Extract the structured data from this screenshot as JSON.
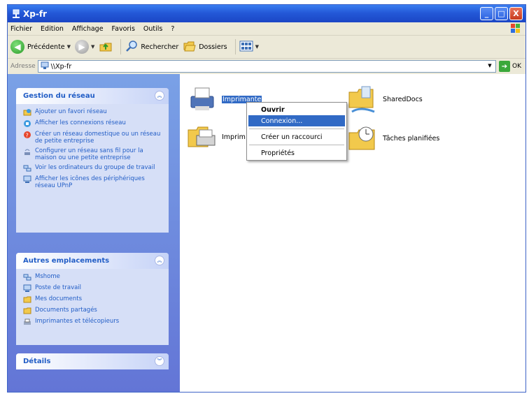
{
  "window": {
    "title": "Xp-fr",
    "buttons": {
      "minimize": "_",
      "maximize": "□",
      "close": "X"
    }
  },
  "menu": [
    "Fichier",
    "Edition",
    "Affichage",
    "Favoris",
    "Outils",
    "?"
  ],
  "toolbar": {
    "back_label": "Précédente",
    "search_label": "Rechercher",
    "folders_label": "Dossiers"
  },
  "address": {
    "label": "Adresse",
    "value": "\\\\Xp-fr",
    "go_label": "OK"
  },
  "sidebar": {
    "network_tasks": {
      "title": "Gestion du réseau",
      "items": [
        {
          "label": "Ajouter un favori réseau",
          "icon": "network-favorite-icon"
        },
        {
          "label": "Afficher les connexions réseau",
          "icon": "network-connections-icon"
        },
        {
          "label": "Créer un réseau domestique ou un réseau de petite entreprise",
          "icon": "home-network-icon"
        },
        {
          "label": "Configurer un réseau sans fil pour la maison ou une petite entreprise",
          "icon": "wireless-network-icon"
        },
        {
          "label": "Voir les ordinateurs du groupe de travail",
          "icon": "workgroup-icon"
        },
        {
          "label": "Afficher les icônes des périphériques réseau UPnP",
          "icon": "upnp-icon"
        }
      ]
    },
    "other_places": {
      "title": "Autres emplacements",
      "items": [
        {
          "label": "Mshome",
          "icon": "workgroup-icon"
        },
        {
          "label": "Poste de travail",
          "icon": "computer-icon"
        },
        {
          "label": "Mes documents",
          "icon": "folder-icon"
        },
        {
          "label": "Documents partagés",
          "icon": "folder-icon"
        },
        {
          "label": "Imprimantes et télécopieurs",
          "icon": "printer-icon"
        }
      ]
    },
    "details": {
      "title": "Détails"
    }
  },
  "items": [
    {
      "label": "Imprimante",
      "icon": "shared-printer-icon",
      "selected": true
    },
    {
      "label": "Imprim",
      "icon": "printer-icon",
      "selected": false
    },
    {
      "label": "SharedDocs",
      "icon": "shared-folder-icon",
      "selected": false
    },
    {
      "label": "Tâches planifiées",
      "icon": "scheduled-tasks-icon",
      "selected": false
    }
  ],
  "context_menu": {
    "items": [
      "Ouvrir",
      "Connexion...",
      "Créer un raccourci",
      "Propriétés"
    ],
    "highlighted": "Connexion..."
  },
  "colors": {
    "title_bar": "#2459d8",
    "sidebar_bg": "#6375d6",
    "panel_title": "#215dc6",
    "selection": "#316ac5"
  }
}
